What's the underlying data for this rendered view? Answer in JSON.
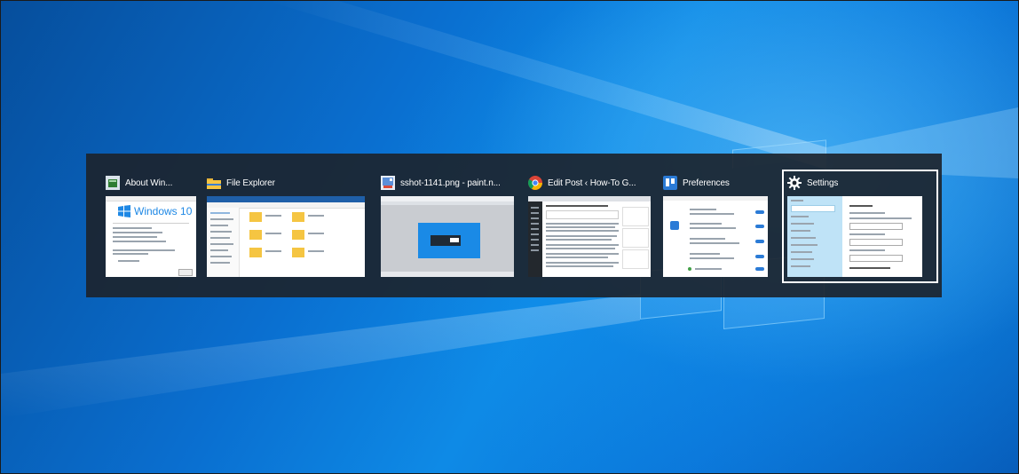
{
  "desktop": {
    "wallpaper": "windows-10-hero",
    "accent_color": "#0a74d8"
  },
  "task_switcher": {
    "selected_index": 5,
    "windows": [
      {
        "title": "About Win...",
        "icon": "winver-icon",
        "thumbnail_text": "Windows 10"
      },
      {
        "title": "File Explorer",
        "icon": "folder-icon"
      },
      {
        "title": "sshot-1141.png - paint.n...",
        "icon": "paint-net-icon"
      },
      {
        "title": "Edit Post ‹ How-To G...",
        "icon": "chrome-icon"
      },
      {
        "title": "Preferences",
        "icon": "trello-icon"
      },
      {
        "title": "Settings",
        "icon": "gear-icon"
      }
    ]
  }
}
